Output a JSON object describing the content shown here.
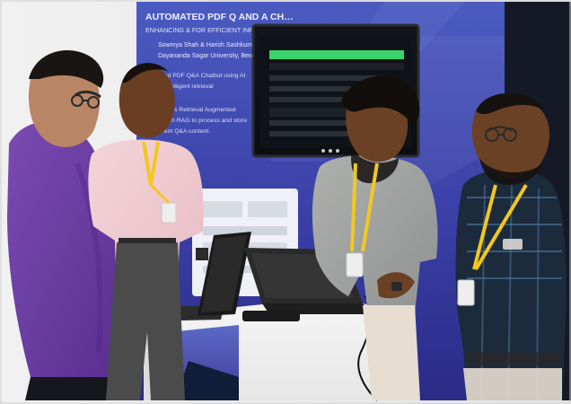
{
  "photo": {
    "banner": {
      "title": "AUTOMATED PDF Q AND A CH…",
      "subtitle": "ENHANCING & FOR EFFICIENT INFORMATION RETRIEVAL",
      "lines": [
        "Sowmya Shah & Harish Sashkumar",
        "Dayananda Sagar University, Bengaluru",
        "…ed PDF Q&A Chatbot using AI",
        "…intelligent retrieval",
        "…ages Retrieval Augmented",
        "…with RAG to process and store",
        "…ent Q&A content."
      ]
    },
    "colors": {
      "banner_top": "#3f4fae",
      "banner_bottom": "#2c2f8c",
      "hoodie": "#6a3aa1",
      "lanyard": "#f2c81f",
      "table": "#f0f0f0",
      "table_blue": "#2f6fd0"
    }
  }
}
